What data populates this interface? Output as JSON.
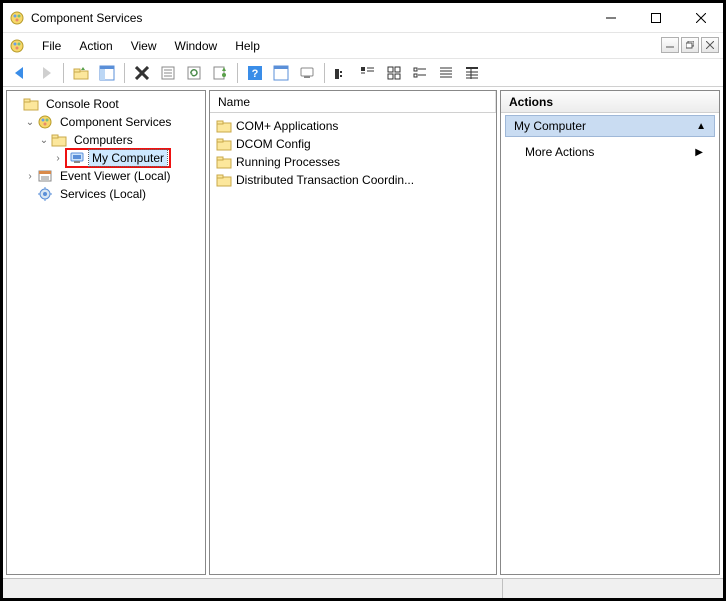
{
  "title": "Component Services",
  "menu": {
    "file": "File",
    "action": "Action",
    "view": "View",
    "window": "Window",
    "help": "Help"
  },
  "tree": {
    "root": "Console Root",
    "comp_services": "Component Services",
    "computers": "Computers",
    "my_computer": "My Computer",
    "event_viewer": "Event Viewer (Local)",
    "services": "Services (Local)"
  },
  "list": {
    "header": "Name",
    "items": [
      "COM+ Applications",
      "DCOM Config",
      "Running Processes",
      "Distributed Transaction Coordin..."
    ]
  },
  "actions": {
    "header": "Actions",
    "context": "My Computer",
    "more": "More Actions"
  }
}
